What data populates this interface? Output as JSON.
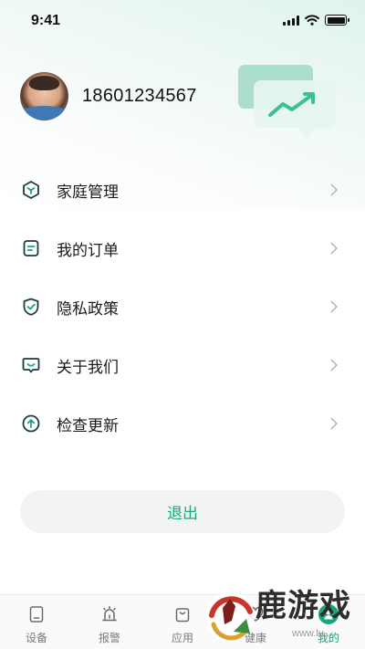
{
  "status_bar": {
    "time": "9:41"
  },
  "profile": {
    "phone": "18601234567"
  },
  "menu": {
    "items": [
      {
        "label": "家庭管理",
        "icon": "house-shield-icon"
      },
      {
        "label": "我的订单",
        "icon": "order-list-icon"
      },
      {
        "label": "隐私政策",
        "icon": "privacy-shield-icon"
      },
      {
        "label": "关于我们",
        "icon": "about-smile-icon"
      },
      {
        "label": "检查更新",
        "icon": "update-arrow-icon"
      }
    ]
  },
  "logout": {
    "label": "退出"
  },
  "tabs": [
    {
      "label": "设备",
      "icon": "device-icon",
      "active": false
    },
    {
      "label": "报警",
      "icon": "alarm-icon",
      "active": false
    },
    {
      "label": "应用",
      "icon": "apps-bag-icon",
      "active": false
    },
    {
      "label": "健康",
      "icon": "health-icon",
      "active": false
    },
    {
      "label": "我的",
      "icon": "profile-icon",
      "active": true
    }
  ],
  "watermark": {
    "text": "鹿游戏",
    "url": "www.lu..."
  },
  "colors": {
    "accent": "#1aa57e",
    "menu_icon_stroke": "#1d3a4a",
    "tab_inactive": "#7b7b7b"
  }
}
